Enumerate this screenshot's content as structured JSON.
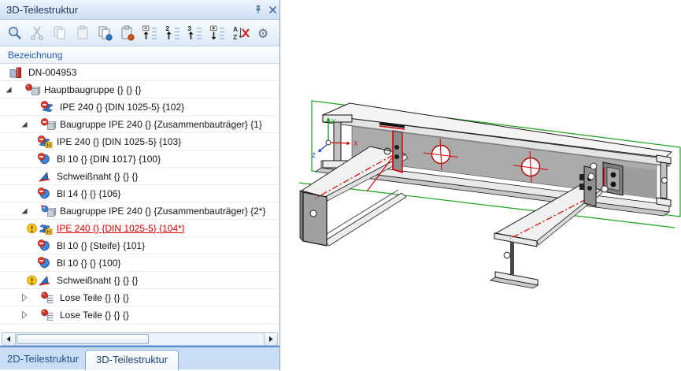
{
  "panel": {
    "title": "3D-Teilestruktur",
    "column_header": "Bezeichnung",
    "toolbar": {
      "buttons": [
        {
          "name": "search",
          "icon": "search-icon",
          "enabled": true
        },
        {
          "name": "cut",
          "icon": "scissors-icon",
          "enabled": false
        },
        {
          "name": "copy",
          "icon": "copy-icon",
          "enabled": false
        },
        {
          "name": "paste",
          "icon": "paste-icon",
          "enabled": false
        },
        {
          "name": "copy-special",
          "icon": "copy-blue-dot-icon",
          "enabled": true
        },
        {
          "name": "paste-special",
          "icon": "paste-red-dot-icon",
          "enabled": true
        },
        {
          "name": "collapse-level-1",
          "icon": "tree-collapse-1-icon",
          "enabled": true
        },
        {
          "name": "collapse-level-2",
          "icon": "tree-collapse-2-icon",
          "enabled": true
        },
        {
          "name": "collapse-level-3",
          "icon": "tree-collapse-3-icon",
          "enabled": true
        },
        {
          "name": "expand-all",
          "icon": "tree-expand-icon",
          "enabled": true
        },
        {
          "name": "remove-sort",
          "icon": "sort-cancel-icon",
          "enabled": true
        },
        {
          "name": "settings",
          "icon": "gear-icon",
          "enabled": true
        }
      ]
    },
    "tree": [
      {
        "level": 0,
        "expander": null,
        "icon": "part-document",
        "warning": false,
        "selected": false,
        "label": "DN-004953"
      },
      {
        "level": 1,
        "expander": "open",
        "icon": "assembly",
        "warning": false,
        "selected": false,
        "label": "Hauptbaugruppe {} {} {}"
      },
      {
        "level": 2,
        "expander": null,
        "icon": "beam-hidden",
        "warning": false,
        "selected": false,
        "label": "IPE 240 {} {DIN 1025-5} {102}"
      },
      {
        "level": 2,
        "expander": "open",
        "icon": "assembly-hidden",
        "warning": false,
        "selected": false,
        "label": "Baugruppe IPE 240 {} {Zusammenbauträger} {1}"
      },
      {
        "level": 3,
        "expander": null,
        "icon": "beam-hidden-h",
        "warning": false,
        "selected": false,
        "label": "IPE 240 {} {DIN 1025-5} {103}"
      },
      {
        "level": 3,
        "expander": null,
        "icon": "plate-hidden",
        "warning": false,
        "selected": false,
        "label": "Bl 10 {} {DIN 1017} {100}"
      },
      {
        "level": 3,
        "expander": null,
        "icon": "weld",
        "warning": false,
        "selected": false,
        "label": "Schweißnaht {} {} {}"
      },
      {
        "level": 3,
        "expander": null,
        "icon": "plate-hidden",
        "warning": false,
        "selected": false,
        "label": "Bl 14 {} {} {106}"
      },
      {
        "level": 2,
        "expander": "open",
        "icon": "assembly-active",
        "warning": false,
        "selected": false,
        "label": "Baugruppe IPE 240 {} {Zusammenbauträger} {2*}"
      },
      {
        "level": 3,
        "expander": null,
        "icon": "beam-h",
        "warning": true,
        "selected": true,
        "label": "IPE 240 {} {DIN 1025-5} {104*}"
      },
      {
        "level": 3,
        "expander": null,
        "icon": "plate-hidden",
        "warning": false,
        "selected": false,
        "label": "Bl 10 {} {Steife} {101}"
      },
      {
        "level": 3,
        "expander": null,
        "icon": "plate-hidden",
        "warning": false,
        "selected": false,
        "label": "Bl 10 {} {} {100}"
      },
      {
        "level": 3,
        "expander": null,
        "icon": "weld",
        "warning": true,
        "selected": false,
        "label": "Schweißnaht {} {} {}"
      },
      {
        "level": 2,
        "expander": "closed",
        "icon": "loose-parts",
        "warning": false,
        "selected": false,
        "label": "Lose Teile {} {} {}"
      },
      {
        "level": 2,
        "expander": "closed",
        "icon": "loose-parts",
        "warning": false,
        "selected": false,
        "label": "Lose Teile {} {} {}"
      }
    ],
    "tabs": [
      {
        "label": "2D-Teilestruktur",
        "active": false
      },
      {
        "label": "3D-Teilestruktur",
        "active": true
      }
    ]
  },
  "viewport": {
    "type": "3d-cad-view",
    "axis_labels": {
      "x": "X",
      "y": "Y",
      "z": "Z"
    },
    "web_hole_count": 2,
    "selection_color": "#1ca41c",
    "centerline_color": "#d60000",
    "background": "#ffffff"
  },
  "colors": {
    "accent": "#4f81bd",
    "selected_text": "#e00000",
    "header_text": "#1d5bb5",
    "title_text": "#1f3a66"
  }
}
